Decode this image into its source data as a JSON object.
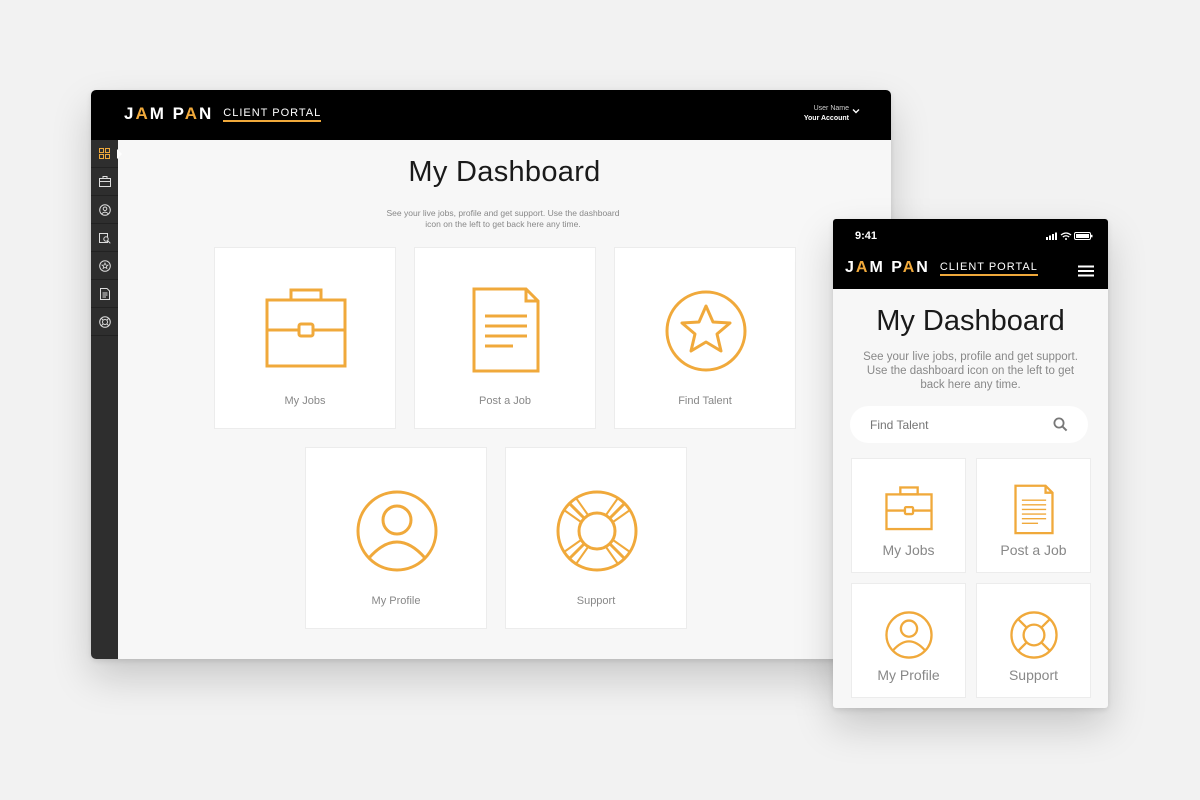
{
  "brand": {
    "name_part1": "J",
    "name_accent": "A",
    "name_part2": "M P",
    "name_accent2": "A",
    "name_part3": "N",
    "portal": "CLIENT PORTAL",
    "accent_color": "#f0a93b"
  },
  "desktop": {
    "account": {
      "user_name": "User Name",
      "account_label": "Your Account"
    },
    "sidebar": [
      "dashboard-icon",
      "briefcase-icon",
      "profile-icon",
      "search-talent-icon",
      "star-icon",
      "document-icon",
      "support-icon"
    ],
    "title": "My Dashboard",
    "subtitle_line1": "See your live jobs, profile and get support. Use the dashboard",
    "subtitle_line2": "icon on the left to get back here any time.",
    "cards": [
      "My Jobs",
      "Post a Job",
      "Find Talent",
      "My Profile",
      "Support"
    ]
  },
  "mobile": {
    "time": "9:41",
    "title": "My Dashboard",
    "subtitle_line1": "See your live jobs, profile and get support.",
    "subtitle_line2": "Use the dashboard icon on the left to get",
    "subtitle_line3": "back here any time.",
    "search_placeholder": "Find Talent",
    "cards": [
      "My Jobs",
      "Post a Job",
      "My Profile",
      "Support"
    ]
  }
}
